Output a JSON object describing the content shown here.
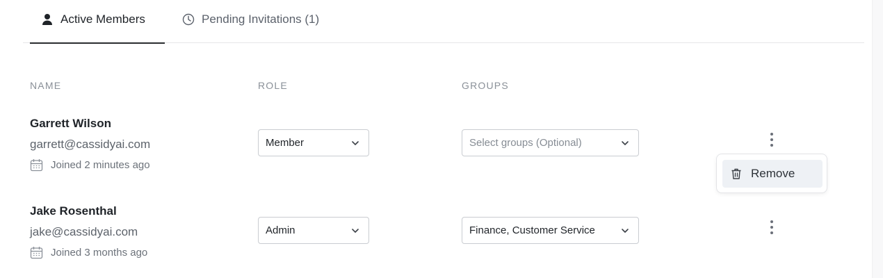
{
  "tabs": {
    "active": {
      "label": "Active Members",
      "icon": "user-icon"
    },
    "pending": {
      "label": "Pending Invitations (1)",
      "icon": "clock-icon"
    }
  },
  "columns": {
    "name": "NAME",
    "role": "ROLE",
    "groups": "GROUPS"
  },
  "members": [
    {
      "name": "Garrett Wilson",
      "email": "garrett@cassidyai.com",
      "joined": "Joined 2 minutes ago",
      "role": "Member",
      "groups_placeholder": "Select groups (Optional)",
      "groups": ""
    },
    {
      "name": "Jake Rosenthal",
      "email": "jake@cassidyai.com",
      "joined": "Joined 3 months ago",
      "role": "Admin",
      "groups_placeholder": "",
      "groups": "Finance, Customer Service"
    }
  ],
  "row_menu": {
    "remove_label": "Remove",
    "icon": "trash-icon"
  },
  "colors": {
    "accent": "#2a2c2f",
    "menu_highlight": "#eef1f5"
  }
}
